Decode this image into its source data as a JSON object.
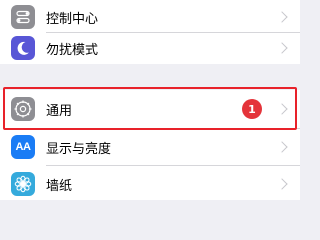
{
  "settings": {
    "rows": [
      {
        "label": "控制中心",
        "icon": "control-center-icon",
        "color": "#8e8e93"
      },
      {
        "label": "勿扰模式",
        "icon": "moon-icon",
        "color": "#5856d6"
      },
      {
        "label": "通用",
        "icon": "gear-icon",
        "color": "#8e8e93",
        "badge": "1",
        "highlighted": true
      },
      {
        "label": "显示与亮度",
        "icon": "display-icon",
        "color": "#1a7cf5",
        "icon_text": "AA"
      },
      {
        "label": "墙纸",
        "icon": "wallpaper-flower-icon",
        "color": "#35aadc"
      }
    ]
  },
  "colors": {
    "background": "#efeff4",
    "highlight_border": "#e8222a",
    "badge": "#e4343a"
  }
}
